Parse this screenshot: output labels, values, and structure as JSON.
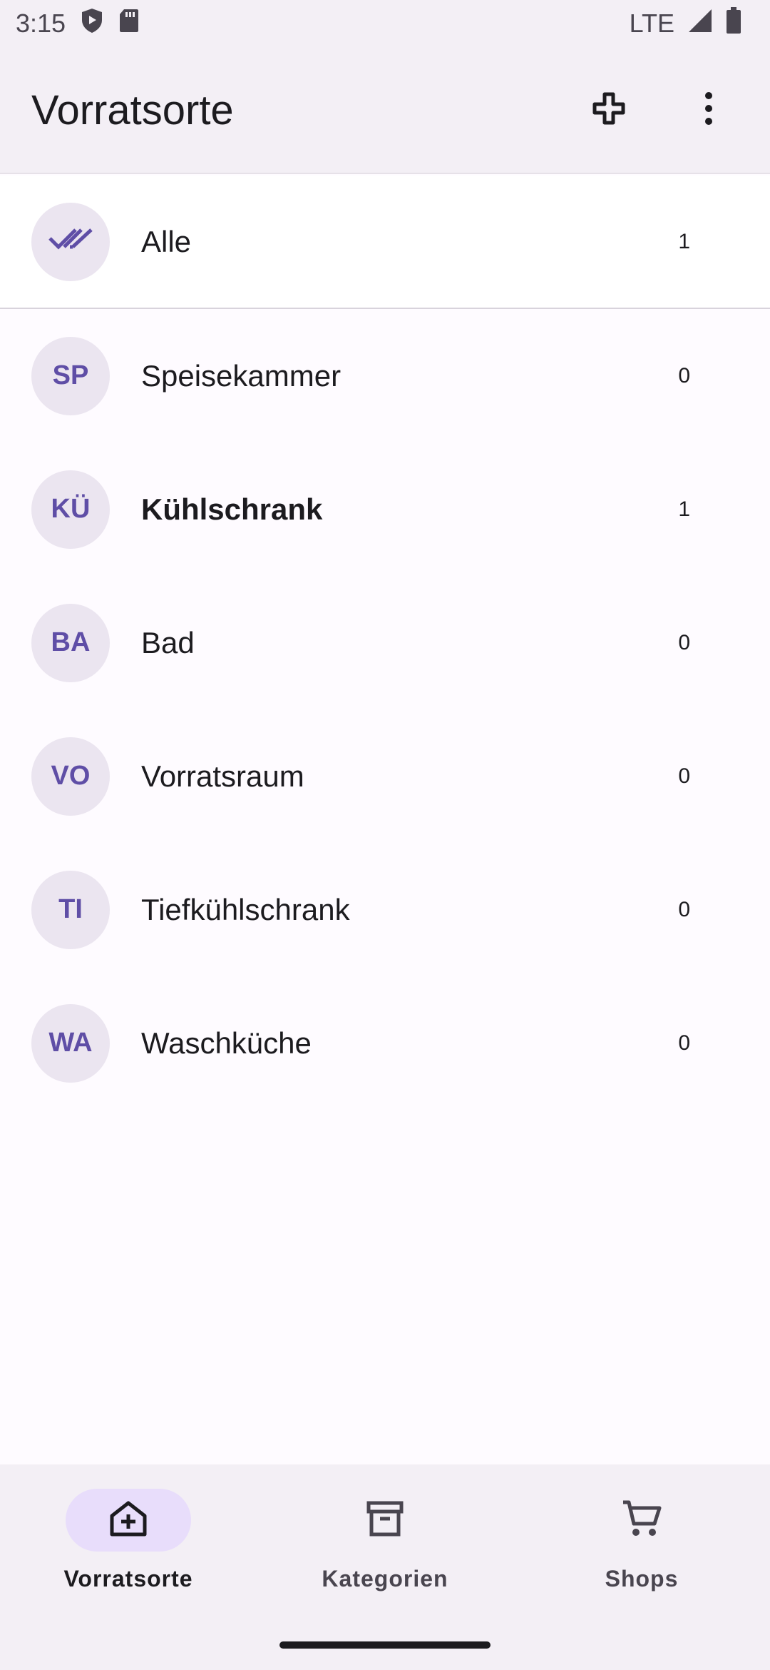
{
  "status_bar": {
    "time": "3:15",
    "network": "LTE",
    "icons": [
      "shield-icon",
      "sd-card-icon",
      "signal-icon",
      "battery-icon"
    ]
  },
  "app_bar": {
    "title": "Vorratsorte",
    "actions": [
      "add-icon",
      "more-vert-icon"
    ]
  },
  "list": {
    "all": {
      "label": "Alle",
      "count": "1",
      "icon": "done-all-icon"
    },
    "items": [
      {
        "initials": "SP",
        "label": "Speisekammer",
        "count": "0",
        "bold": false
      },
      {
        "initials": "KÜ",
        "label": "Kühlschrank",
        "count": "1",
        "bold": true
      },
      {
        "initials": "BA",
        "label": "Bad",
        "count": "0",
        "bold": false
      },
      {
        "initials": "VO",
        "label": "Vorratsraum",
        "count": "0",
        "bold": false
      },
      {
        "initials": "TI",
        "label": "Tiefkühlschrank",
        "count": "0",
        "bold": false
      },
      {
        "initials": "WA",
        "label": "Waschküche",
        "count": "0",
        "bold": false
      }
    ]
  },
  "bottom_nav": {
    "items": [
      {
        "label": "Vorratsorte",
        "icon": "home-add-icon",
        "active": true
      },
      {
        "label": "Kategorien",
        "icon": "archive-box-icon",
        "active": false
      },
      {
        "label": "Shops",
        "icon": "shopping-cart-icon",
        "active": false
      }
    ]
  },
  "colors": {
    "accent": "#5f4ea6",
    "avatar_bg": "#ebe5f0",
    "surface": "#f3eff5",
    "nav_active_pill": "#e8ddfb"
  }
}
